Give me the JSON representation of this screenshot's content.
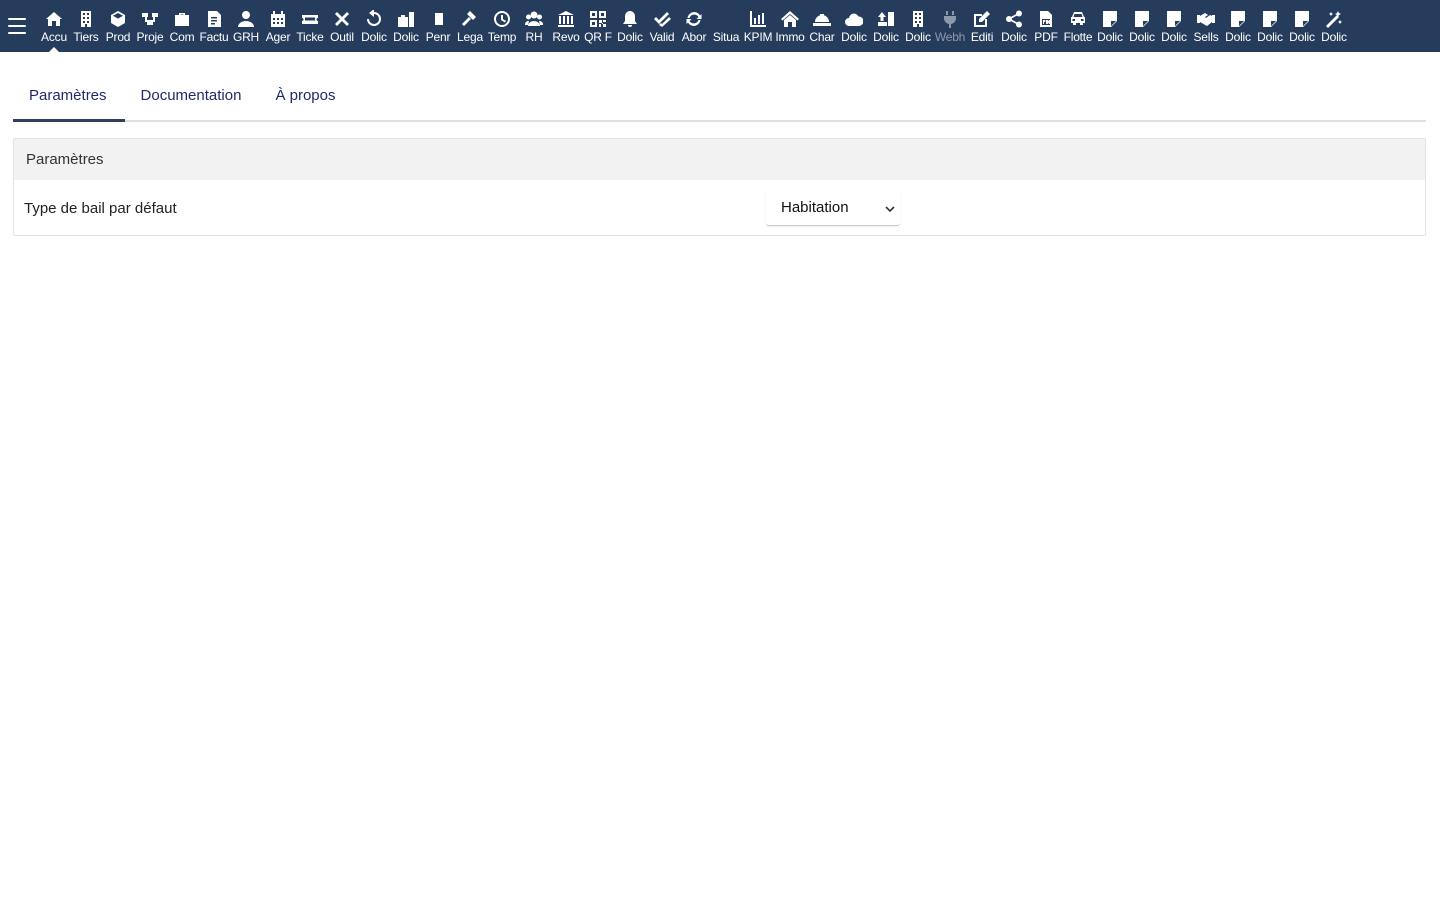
{
  "topbar": {
    "menu_icon": "hamburger-icon",
    "items": [
      {
        "label": "Accu",
        "icon": "home-icon",
        "active": true
      },
      {
        "label": "Tiers",
        "icon": "building-icon"
      },
      {
        "label": "Prod",
        "icon": "cube-icon"
      },
      {
        "label": "Proje",
        "icon": "project-icon"
      },
      {
        "label": "Com",
        "icon": "briefcase-icon"
      },
      {
        "label": "Factu",
        "icon": "invoice-icon"
      },
      {
        "label": "GRH",
        "icon": "user-icon"
      },
      {
        "label": "Ager",
        "icon": "calendar-icon"
      },
      {
        "label": "Ticke",
        "icon": "ticket-icon"
      },
      {
        "label": "Outil",
        "icon": "tools-icon"
      },
      {
        "label": "Dolic",
        "icon": "undo-icon"
      },
      {
        "label": "Dolic",
        "icon": "suitcase-icon"
      },
      {
        "label": "Penr",
        "icon": "file-icon"
      },
      {
        "label": "Lega",
        "icon": "gavel-icon"
      },
      {
        "label": "Temp",
        "icon": "clock-icon"
      },
      {
        "label": "RH",
        "icon": "users-icon"
      },
      {
        "label": "Revo",
        "icon": "bank-icon"
      },
      {
        "label": "QR F",
        "icon": "qrcode-icon"
      },
      {
        "label": "Dolic",
        "icon": "bell-icon"
      },
      {
        "label": "Valid",
        "icon": "check-double-icon"
      },
      {
        "label": "Abor",
        "icon": "sync-icon"
      },
      {
        "label": "Situa",
        "icon": "blank-icon"
      },
      {
        "label": "KPIM",
        "icon": "chart-bar-icon"
      },
      {
        "label": "Immo",
        "icon": "house-icon"
      },
      {
        "label": "Char",
        "icon": "helmet-icon"
      },
      {
        "label": "Dolic",
        "icon": "cloud-icon"
      },
      {
        "label": "Dolic",
        "icon": "upload-icon"
      },
      {
        "label": "Dolic",
        "icon": "building-icon"
      },
      {
        "label": "Webh",
        "icon": "plug-icon",
        "disabled": true
      },
      {
        "label": "Editi",
        "icon": "edit-icon"
      },
      {
        "label": "Dolic",
        "icon": "share-icon"
      },
      {
        "label": "PDF",
        "icon": "pdf-icon"
      },
      {
        "label": "Flotte",
        "icon": "car-icon"
      },
      {
        "label": "Dolic",
        "icon": "note-icon"
      },
      {
        "label": "Dolic",
        "icon": "note-icon"
      },
      {
        "label": "Dolic",
        "icon": "note-icon"
      },
      {
        "label": "Sells",
        "icon": "handshake-icon"
      },
      {
        "label": "Dolic",
        "icon": "note-icon"
      },
      {
        "label": "Dolic",
        "icon": "note-icon"
      },
      {
        "label": "Dolic",
        "icon": "note-icon"
      },
      {
        "label": "Dolic",
        "icon": "magic-icon"
      }
    ]
  },
  "tabs": [
    {
      "label": "Paramètres",
      "active": true
    },
    {
      "label": "Documentation"
    },
    {
      "label": "À propos"
    }
  ],
  "panel": {
    "title": "Paramètres",
    "row_label": "Type de bail par défaut",
    "select_value": "Habitation",
    "select_icon": "chevron-down-icon"
  },
  "colors": {
    "topbar_bg": "#263c5c",
    "tab_text": "#1f2a6b",
    "panel_head_bg": "#f2f2f2"
  }
}
